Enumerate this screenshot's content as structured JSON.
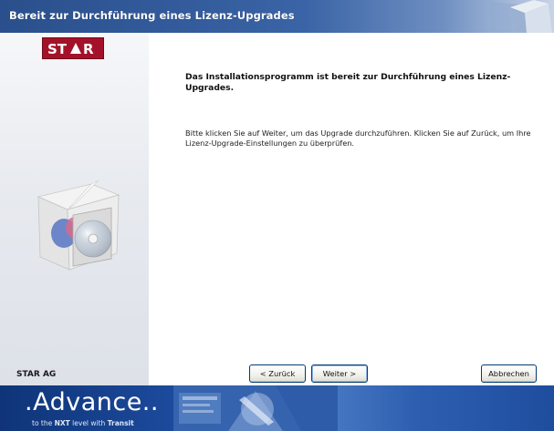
{
  "window": {
    "title": "Bereit zur Durchführung eines Lizenz-Upgrades"
  },
  "sidebar": {
    "logo_text": "STAR",
    "company": "STAR AG"
  },
  "main": {
    "heading": "Das Installationsprogramm ist bereit zur Durchführung eines Lizenz-Upgrades.",
    "body": "Bitte klicken Sie auf Weiter, um das Upgrade durchzuführen. Klicken Sie auf Zurück, um Ihre Lizenz-Upgrade-Einstellungen zu überprüfen."
  },
  "buttons": {
    "back": "< Zurück",
    "next": "Weiter >",
    "cancel": "Abbrechen"
  },
  "banner": {
    "brand": ".Advance..",
    "tagline_prefix": "to the ",
    "tagline_bold1": "NXT",
    "tagline_mid": " level with ",
    "tagline_bold2": "Transit"
  },
  "colors": {
    "title_bar": "#2a4f8c",
    "logo_red": "#a4122a",
    "banner_blue": "#1d4a9a",
    "button_border": "#003c74"
  }
}
